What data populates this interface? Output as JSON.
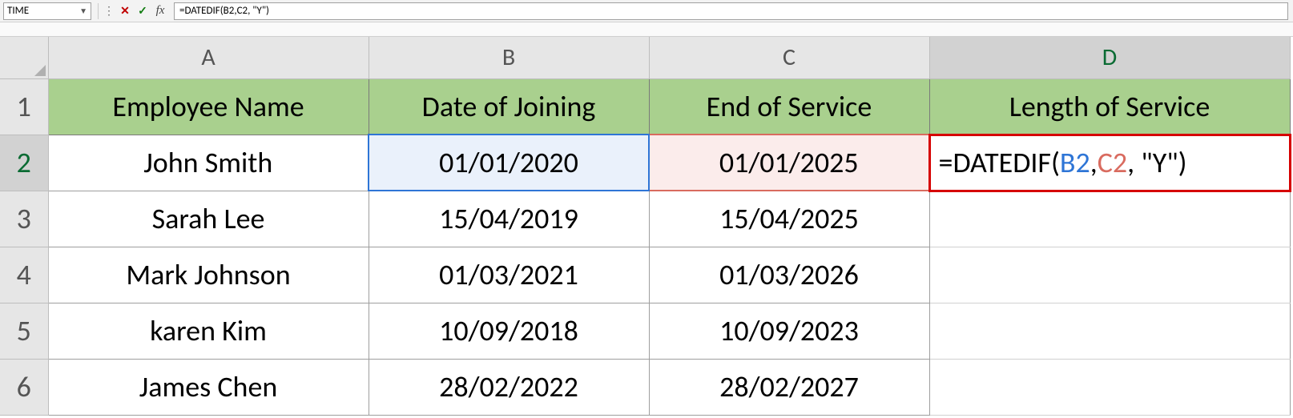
{
  "formula_bar": {
    "name_box": "TIME",
    "cancel_glyph": "✕",
    "confirm_glyph": "✓",
    "fx_glyph": "fx",
    "formula_text": "=DATEDIF(B2,C2, \"Y\")"
  },
  "columns": [
    {
      "letter": "A",
      "active": false
    },
    {
      "letter": "B",
      "active": false
    },
    {
      "letter": "C",
      "active": false
    },
    {
      "letter": "D",
      "active": true
    }
  ],
  "row_headers": [
    {
      "n": "1",
      "active": false
    },
    {
      "n": "2",
      "active": true
    },
    {
      "n": "3",
      "active": false
    },
    {
      "n": "4",
      "active": false
    },
    {
      "n": "5",
      "active": false
    },
    {
      "n": "6",
      "active": false
    }
  ],
  "headers": {
    "a": "Employee Name",
    "b": "Date of Joining",
    "c": "End of Service",
    "d": "Length of Service"
  },
  "rows": [
    {
      "name": "John Smith",
      "join": "01/01/2020",
      "end": "01/01/2025",
      "len_formula": {
        "eq": "=",
        "fn": "DATEDIF(",
        "b2": "B2",
        "comma1": ",",
        "c2": "C2",
        "rest": ", \"Y\")"
      }
    },
    {
      "name": "Sarah Lee",
      "join": "15/04/2019",
      "end": "15/04/2025",
      "len": ""
    },
    {
      "name": "Mark Johnson",
      "join": "01/03/2021",
      "end": "01/03/2026",
      "len": ""
    },
    {
      "name": "karen Kim",
      "join": "10/09/2018",
      "end": "10/09/2023",
      "len": ""
    },
    {
      "name": "James Chen",
      "join": "28/02/2022",
      "end": "28/02/2027",
      "len": ""
    }
  ],
  "chart_data": {
    "type": "table",
    "columns": [
      "Employee Name",
      "Date of Joining",
      "End of Service",
      "Length of Service"
    ],
    "rows": [
      [
        "John Smith",
        "01/01/2020",
        "01/01/2025",
        "=DATEDIF(B2,C2, \"Y\")"
      ],
      [
        "Sarah Lee",
        "15/04/2019",
        "15/04/2025",
        ""
      ],
      [
        "Mark Johnson",
        "01/03/2021",
        "01/03/2026",
        ""
      ],
      [
        "karen Kim",
        "10/09/2018",
        "10/09/2023",
        ""
      ],
      [
        "James Chen",
        "28/02/2022",
        "28/02/2027",
        ""
      ]
    ]
  }
}
